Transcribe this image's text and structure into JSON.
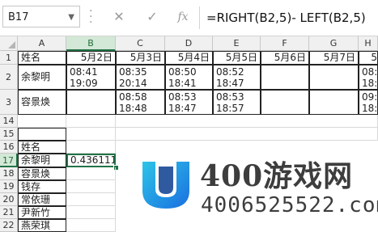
{
  "formula_bar": {
    "name_box": "B17",
    "formula": "=RIGHT(B2,5)- LEFT(B2,5)",
    "fx_label": "fx"
  },
  "columns": [
    "A",
    "B",
    "C",
    "D",
    "E",
    "F",
    "G",
    "H"
  ],
  "rows": {
    "r1": {
      "num": "1",
      "A": "姓名",
      "B": "5月2日",
      "C": "5月3日",
      "D": "5月4日",
      "E": "5月5日",
      "F": "5月6日",
      "G": "5月7日",
      "H": "5"
    },
    "r2": {
      "num": "2",
      "A": "余黎明",
      "B1": "08:41",
      "B2": "19:09",
      "C1": "08:35",
      "C2": "20:14",
      "D1": "08:50",
      "D2": "18:41",
      "E1": "08:52",
      "E2": "18:47",
      "H1": "08:5",
      "H2": "18:4"
    },
    "r3": {
      "num": "3",
      "A": "容景焕",
      "C1": "08:58",
      "C2": "18:48",
      "D1": "08:53",
      "D2": "18:47",
      "E1": "08:53",
      "E2": "18:57",
      "H1": "09:0",
      "H2": "18:4"
    },
    "r14": {
      "num": "14"
    },
    "r15": {
      "num": "15"
    },
    "r16": {
      "num": "16",
      "A": "姓名"
    },
    "r17": {
      "num": "17",
      "A": "余黎明",
      "B": "0.4361111"
    },
    "r18": {
      "num": "18",
      "A": "容景焕"
    },
    "r19": {
      "num": "19",
      "A": "钱存"
    },
    "r20": {
      "num": "20",
      "A": "常依珊"
    },
    "r21": {
      "num": "21",
      "A": "尹新竹"
    },
    "r22": {
      "num": "22",
      "A": "燕荣琪"
    }
  },
  "watermark": {
    "site": "400游戏网",
    "phone": "4006525522.com",
    "colors": {
      "primary": "#1a8fe0",
      "secondary": "#2ec4e8",
      "text": "#3d3d3d"
    }
  },
  "colors": {
    "accent": "#217346",
    "header_bg": "#f0f0f0",
    "gridline": "#d9d9d9"
  }
}
